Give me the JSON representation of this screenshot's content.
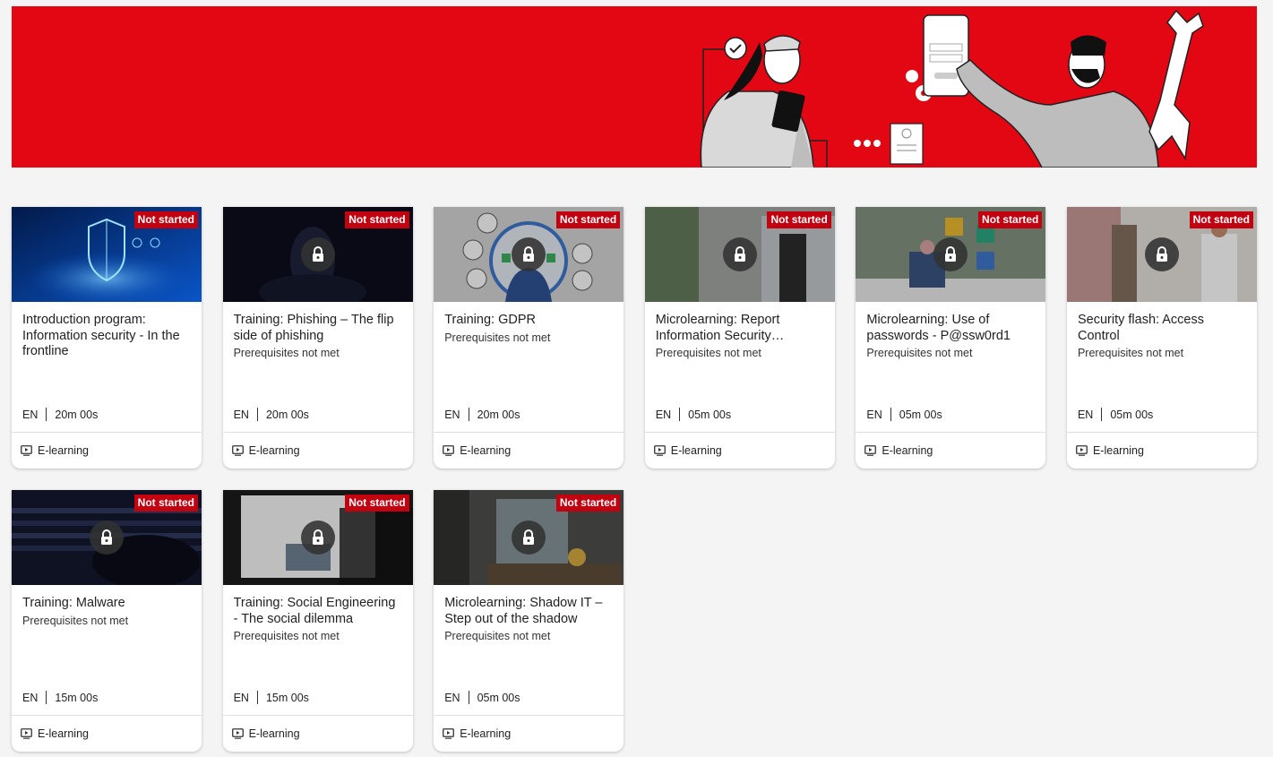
{
  "banner": {
    "alt": "Security illustration banner"
  },
  "courses": [
    {
      "title": "Introduction program: Information security - In the frontline",
      "status": "Not started",
      "prereq": "",
      "locked": false,
      "lang": "EN",
      "duration": "20m 00s",
      "type": "E-learning",
      "thumb": "t1"
    },
    {
      "title": "Training: Phishing – The flip side of phishing",
      "status": "Not started",
      "prereq": "Prerequisites not met",
      "locked": true,
      "lang": "EN",
      "duration": "20m 00s",
      "type": "E-learning",
      "thumb": "t2"
    },
    {
      "title": "Training: GDPR",
      "status": "Not started",
      "prereq": "Prerequisites not met",
      "locked": true,
      "lang": "EN",
      "duration": "20m 00s",
      "type": "E-learning",
      "thumb": "t3"
    },
    {
      "title": "Microlearning: Report Information Security…",
      "status": "Not started",
      "prereq": "Prerequisites not met",
      "locked": true,
      "lang": "EN",
      "duration": "05m 00s",
      "type": "E-learning",
      "thumb": "t4"
    },
    {
      "title": "Microlearning: Use of passwords - P@ssw0rd1",
      "status": "Not started",
      "prereq": "Prerequisites not met",
      "locked": true,
      "lang": "EN",
      "duration": "05m 00s",
      "type": "E-learning",
      "thumb": "t5"
    },
    {
      "title": "Security flash: Access Control",
      "status": "Not started",
      "prereq": "Prerequisites not met",
      "locked": true,
      "lang": "EN",
      "duration": "05m 00s",
      "type": "E-learning",
      "thumb": "t6"
    },
    {
      "title": "Training: Malware",
      "status": "Not started",
      "prereq": "Prerequisites not met",
      "locked": true,
      "lang": "EN",
      "duration": "15m 00s",
      "type": "E-learning",
      "thumb": "t7"
    },
    {
      "title": "Training: Social Engineering - The social dilemma",
      "status": "Not started",
      "prereq": "Prerequisites not met",
      "locked": true,
      "lang": "EN",
      "duration": "15m 00s",
      "type": "E-learning",
      "thumb": "t8"
    },
    {
      "title": "Microlearning: Shadow IT – Step out of the shadow",
      "status": "Not started",
      "prereq": "Prerequisites not met",
      "locked": true,
      "lang": "EN",
      "duration": "05m 00s",
      "type": "E-learning",
      "thumb": "t9"
    }
  ],
  "icons": {
    "lock": "lock-icon",
    "play": "video-play-icon"
  },
  "colors": {
    "brand_red": "#e30613",
    "badge_red": "#c30010"
  }
}
